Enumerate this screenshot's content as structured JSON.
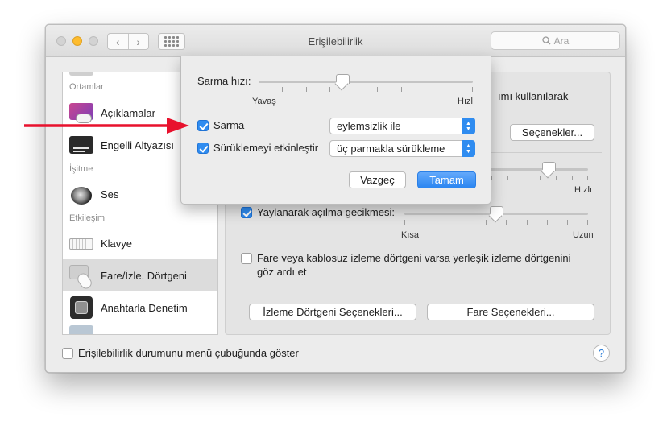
{
  "window": {
    "title": "Erişilebilirlik",
    "search_placeholder": "Ara",
    "nav_back": "‹",
    "nav_forward": "›"
  },
  "sidebar": {
    "sections": [
      {
        "label": "Ortamlar"
      },
      {
        "label": "İşitme"
      },
      {
        "label": "Etkileşim"
      }
    ],
    "items": [
      {
        "label": "Açıklamalar",
        "icon": "descriptions-icon"
      },
      {
        "label": "Engelli Altyazısı",
        "icon": "captions-icon"
      },
      {
        "label": "Ses",
        "icon": "speaker-icon"
      },
      {
        "label": "Klavye",
        "icon": "keyboard-icon"
      },
      {
        "label": "Fare/İzle. Dörtgeni",
        "icon": "mouse-trackpad-icon",
        "selected": true
      },
      {
        "label": "Anahtarla Denetim",
        "icon": "switch-control-icon"
      }
    ]
  },
  "main": {
    "partial_text": "ımı kullanılarak",
    "options_button": "Seçenekler...",
    "double_click_speed_fast": "Hızlı",
    "spring_loading": {
      "checked": true,
      "label": "Yaylanarak açılma gecikmesi:",
      "min_label": "Kısa",
      "max_label": "Uzun"
    },
    "ignore_trackpad": {
      "checked": false,
      "label_line1": "Fare veya kablosuz izleme dörtgeni varsa yerleşik izleme dörtgenini",
      "label_line2": "göz ardı et"
    },
    "trackpad_options_button": "İzleme Dörtgeni Seçenekleri...",
    "mouse_options_button": "Fare Seçenekleri..."
  },
  "sheet": {
    "scroll_speed_label": "Sarma hızı:",
    "slow_label": "Yavaş",
    "fast_label": "Hızlı",
    "scroll_speed_fraction": 0.39,
    "scrolling": {
      "checked": true,
      "label": "Sarma",
      "popup_value": "eylemsizlik ile"
    },
    "dragging": {
      "checked": true,
      "label": "Sürüklemeyi etkinleştir",
      "popup_value": "üç parmakla sürükleme"
    },
    "cancel_button": "Vazgeç",
    "ok_button": "Tamam"
  },
  "footer": {
    "status_checkbox_checked": false,
    "status_checkbox_label": "Erişilebilirlik durumunu menü çubuğunda göster",
    "help_glyph": "?"
  },
  "annotation": {
    "arrow_color": "#e8112d"
  },
  "colors": {
    "accent": "#2f8cf0",
    "window_bg": "#ececec"
  }
}
